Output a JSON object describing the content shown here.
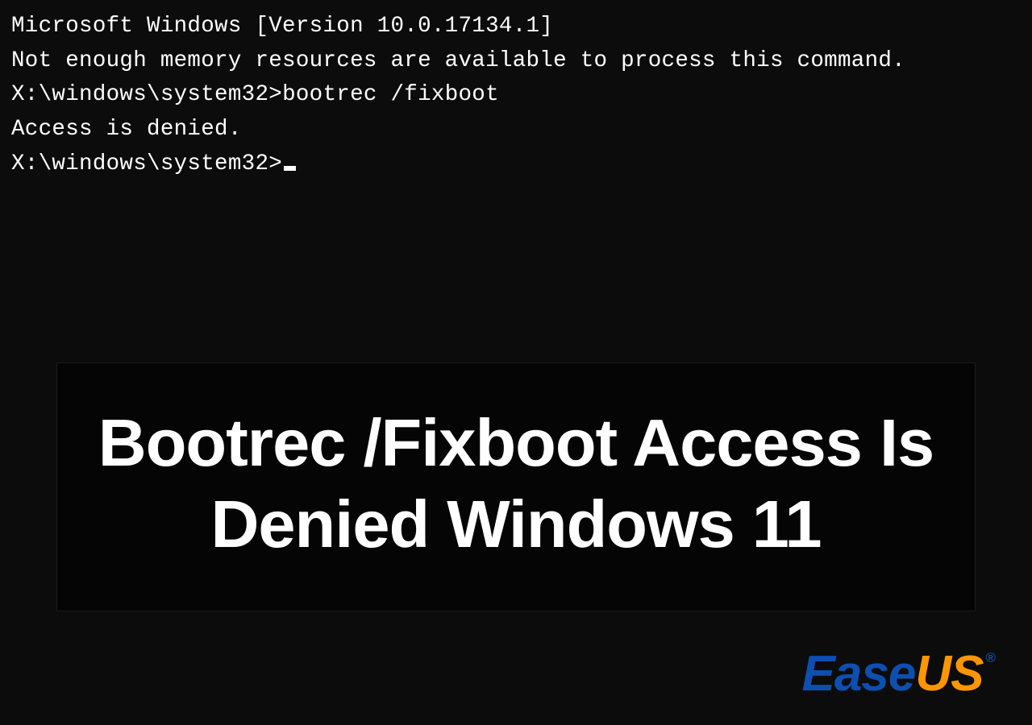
{
  "terminal": {
    "line1": "Microsoft Windows [Version 10.0.17134.1]",
    "line2": "Not enough memory resources are available to process this command.",
    "blank1": "",
    "prompt1_prefix": "X:\\windows\\system32>",
    "prompt1_cmd": "bootrec /fixboot",
    "response1": "Access is denied.",
    "blank2": "",
    "prompt2_prefix": "X:\\windows\\system32>"
  },
  "overlay": {
    "title_line1": "Bootrec /Fixboot Access Is",
    "title_line2": "Denied Windows 11"
  },
  "brand": {
    "part1": "Ease",
    "part2": "US",
    "reg": "®"
  }
}
